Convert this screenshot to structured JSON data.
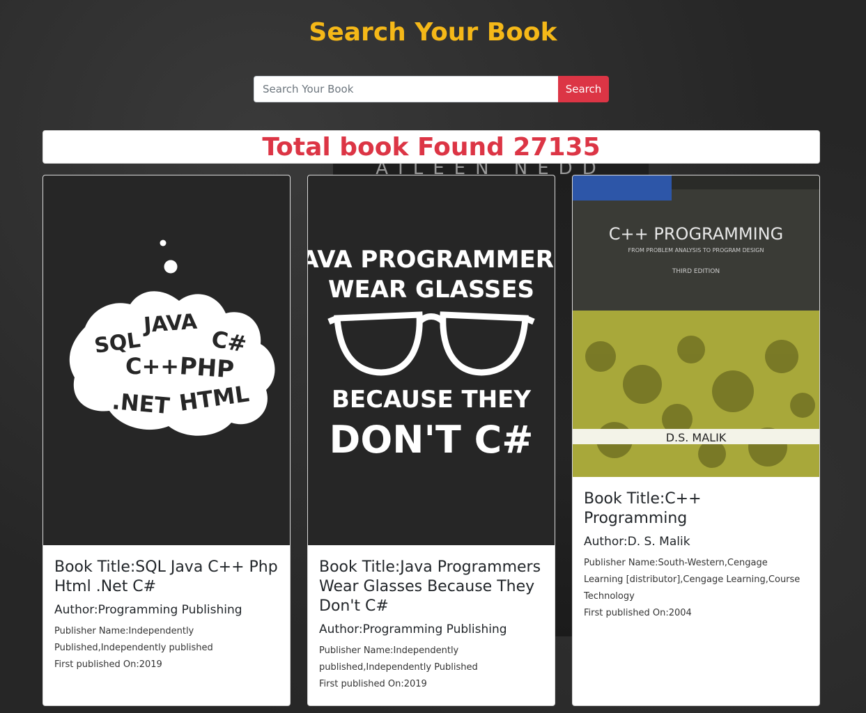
{
  "header": {
    "title": "Search Your Book"
  },
  "search": {
    "placeholder": "Search Your Book",
    "value": "",
    "button_label": "Search"
  },
  "background": {
    "cover_text": "AILEEN NEDD"
  },
  "results": {
    "total_label": "Total book Found 27135"
  },
  "books": [
    {
      "title": "Book Title:SQL Java C++ Php Html .Net C#",
      "author": "Author:Programming Publishing",
      "publisher": "Publisher Name:Independently Published,Independently published",
      "first_published": "First published On:2019",
      "cover_words": [
        "SQL",
        "JAVA",
        "C#",
        "C++",
        "PHP",
        ".NET",
        "HTML"
      ]
    },
    {
      "title": "Book Title:Java Programmers Wear Glasses Because They Don't C#",
      "author": "Author:Programming Publishing",
      "publisher": "Publisher Name:Independently published,Independently Published",
      "first_published": "First published On:2019",
      "cover_lines": [
        "JAVA PROGRAMMERS",
        "WEAR GLASSES",
        "BECAUSE THEY",
        "DON'T C#"
      ]
    },
    {
      "title": "Book Title:C++ Programming",
      "author": "Author:D. S. Malik",
      "publisher": "Publisher Name:South-Western,Cengage Learning [distributor],Cengage Learning,Course Technology",
      "first_published": "First published On:2004",
      "cover_title": "C++ PROGRAMMING",
      "cover_subtitle": "FROM PROBLEM ANALYSIS TO PROGRAM DESIGN",
      "cover_edition": "THIRD EDITION",
      "cover_author": "D.S. MALIK"
    }
  ],
  "colors": {
    "title": "#f5b818",
    "accent": "#dc3545",
    "cover_dark": "#262626",
    "cover_olive": "#a8a83a"
  }
}
